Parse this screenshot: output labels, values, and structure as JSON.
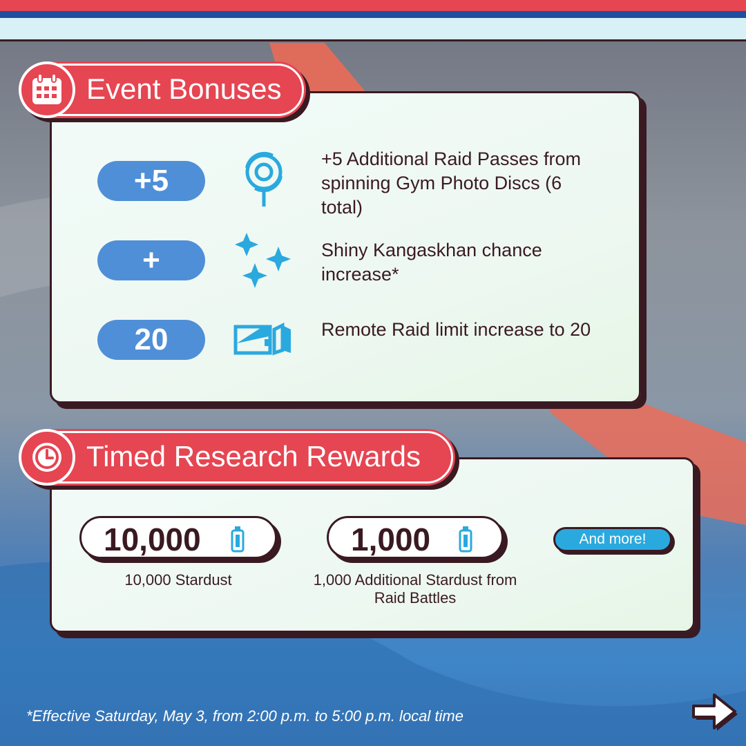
{
  "event_bonuses": {
    "title": "Event Bonuses",
    "icon": "calendar-icon",
    "items": [
      {
        "badge": "+5",
        "icon": "raid-pass-icon",
        "text": "+5 Additional Raid Passes from spinning Gym Photo Discs (6 total)"
      },
      {
        "badge": "+",
        "icon": "sparkles-icon",
        "text": "Shiny Kangaskhan chance increase*"
      },
      {
        "badge": "20",
        "icon": "remote-raid-pass-icon",
        "text": "Remote Raid limit increase to 20"
      }
    ]
  },
  "timed_research": {
    "title": "Timed Research Rewards",
    "icon": "clock-icon",
    "rewards": [
      {
        "value": "10,000",
        "icon": "stardust-icon",
        "caption": "10,000 Stardust"
      },
      {
        "value": "1,000",
        "icon": "stardust-icon",
        "caption": "1,000 Additional Stardust from Raid Battles"
      }
    ],
    "more_label": "And more!"
  },
  "footnote": "*Effective Saturday, May 3, from 2:00 p.m. to 5:00 p.m. local time",
  "next_icon": "arrow-right-icon",
  "colors": {
    "accent_red": "#e64552",
    "badge_blue": "#4f8fd8",
    "dark_outline": "#3a1a22",
    "icon_cyan": "#2aa9df"
  }
}
